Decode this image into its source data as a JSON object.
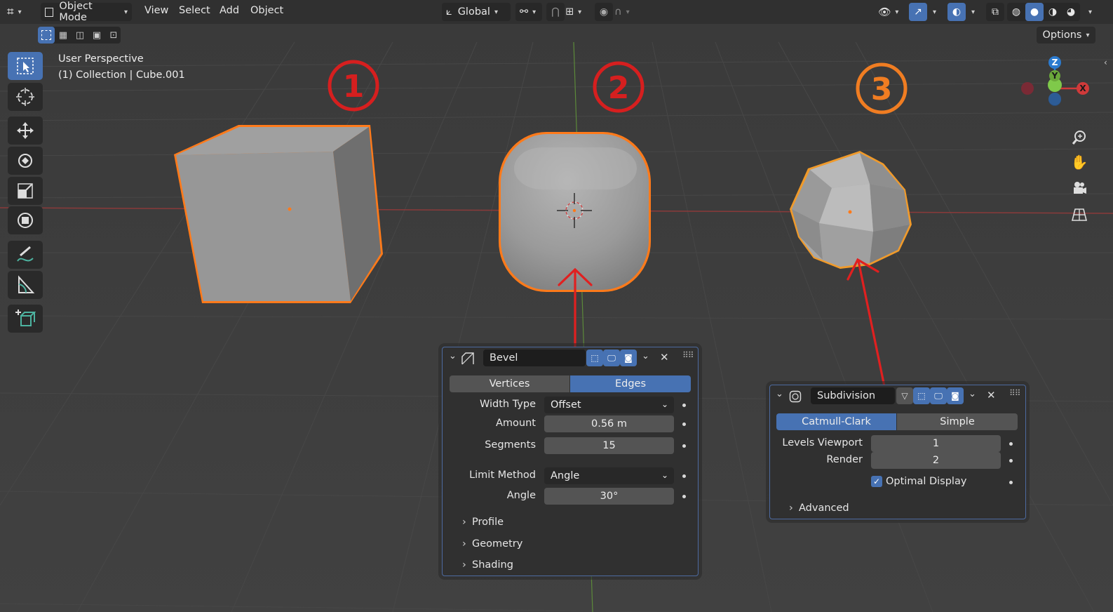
{
  "header": {
    "mode_label": "Object Mode",
    "menu": [
      "View",
      "Select",
      "Add",
      "Object"
    ],
    "orientation_label": "Global",
    "options_label": "Options"
  },
  "overlay_text": {
    "perspective": "User Perspective",
    "collection": "(1) Collection | Cube.001"
  },
  "gizmo": {
    "x": "X",
    "y": "Y",
    "z": "Z"
  },
  "annotations": [
    {
      "label": "①",
      "color": "#d61f1f"
    },
    {
      "label": "②",
      "color": "#d61f1f"
    },
    {
      "label": "③",
      "color": "#f07d22"
    }
  ],
  "bevel_panel": {
    "name": "Bevel",
    "tabs": [
      "Vertices",
      "Edges"
    ],
    "active_tab": "Edges",
    "width_type_label": "Width Type",
    "width_type_value": "Offset",
    "amount_label": "Amount",
    "amount_value": "0.56 m",
    "segments_label": "Segments",
    "segments_value": "15",
    "limit_method_label": "Limit Method",
    "limit_method_value": "Angle",
    "angle_label": "Angle",
    "angle_value": "30°",
    "subpanels": [
      "Profile",
      "Geometry",
      "Shading"
    ]
  },
  "subdivision_panel": {
    "name": "Subdivision",
    "tabs": [
      "Catmull-Clark",
      "Simple"
    ],
    "active_tab": "Catmull-Clark",
    "levels_viewport_label": "Levels Viewport",
    "levels_viewport_value": "1",
    "render_label": "Render",
    "render_value": "2",
    "optimal_display_label": "Optimal Display",
    "optimal_display_checked": true,
    "advanced_label": "Advanced"
  },
  "colors": {
    "accent": "#4772b3",
    "selection_outline": "#ff7a1a",
    "annotation_red": "#d61f1f",
    "annotation_orange": "#f07d22"
  }
}
